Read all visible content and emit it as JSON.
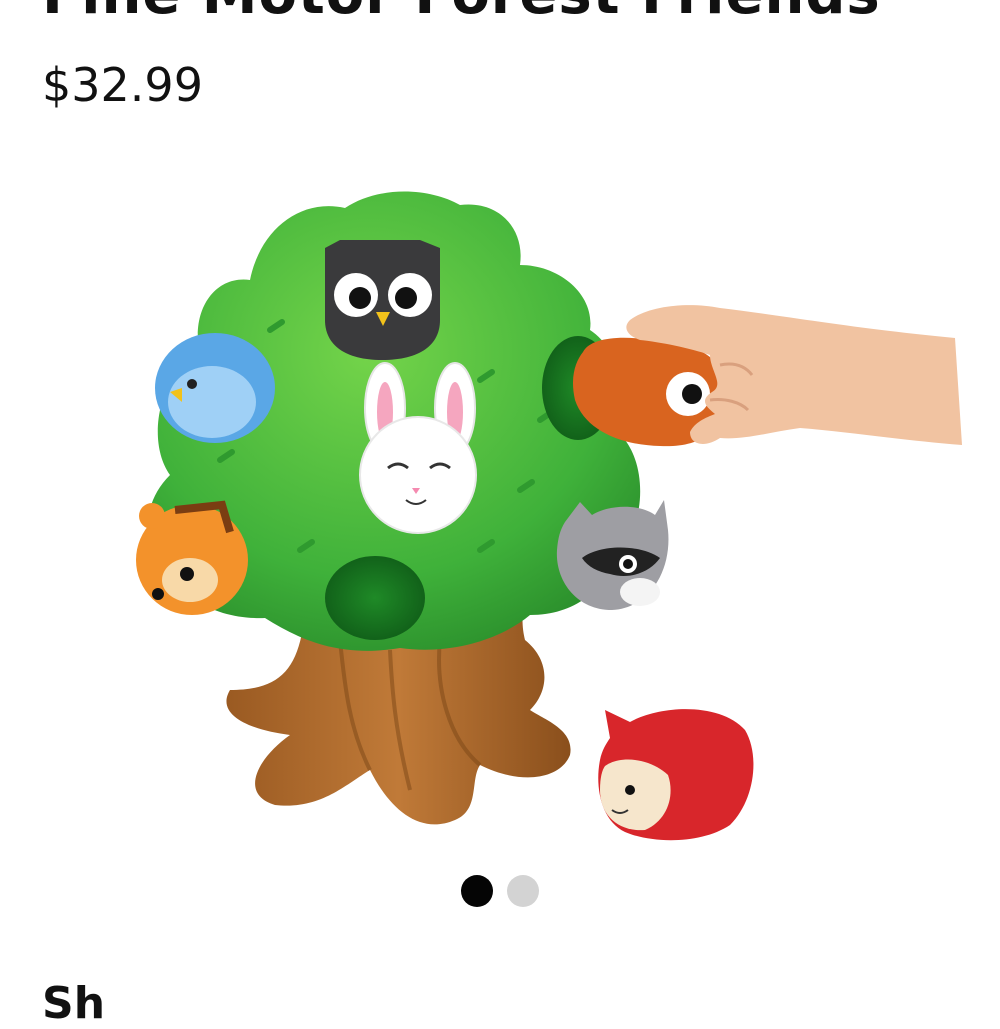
{
  "product": {
    "title": "Fine Motor Forest Friends",
    "price": "$32.99"
  },
  "gallery": {
    "total_images": 2,
    "active_index": 1
  },
  "next_section": {
    "heading": "Sh"
  }
}
